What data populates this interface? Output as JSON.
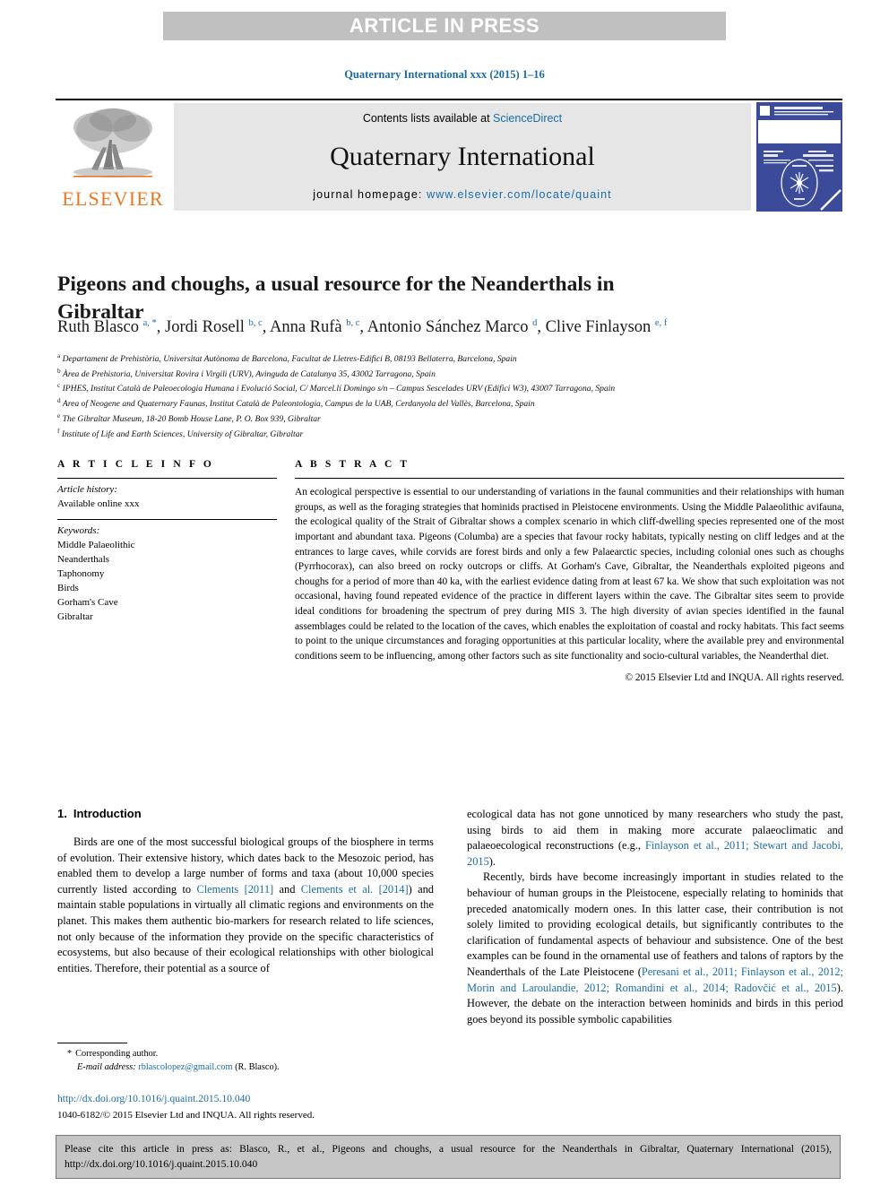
{
  "banner": {
    "label": "ARTICLE IN PRESS"
  },
  "journal_ref": "Quaternary International xxx (2015) 1–16",
  "masthead": {
    "publisher": "ELSEVIER",
    "contents_prefix": "Contents lists available at ",
    "contents_link": "ScienceDirect",
    "journal_title": "Quaternary International",
    "homepage_prefix": "journal homepage: ",
    "homepage_url": "www.elsevier.com/locate/quaint",
    "cover_caption": "Quaternary International"
  },
  "article": {
    "title": "Pigeons and choughs, a usual resource for the Neanderthals in Gibraltar",
    "authors": [
      {
        "name": "Ruth Blasco",
        "marks": "a, *"
      },
      {
        "name": "Jordi Rosell",
        "marks": "b, c"
      },
      {
        "name": "Anna Rufà",
        "marks": "b, c"
      },
      {
        "name": "Antonio Sánchez Marco",
        "marks": "d"
      },
      {
        "name": "Clive Finlayson",
        "marks": "e, f"
      }
    ],
    "affiliations": [
      {
        "mark": "a",
        "text": "Departament de Prehistòria, Universitat Autònoma de Barcelona, Facultat de Lletres-Edifici B, 08193 Bellaterra, Barcelona, Spain"
      },
      {
        "mark": "b",
        "text": "Àrea de Prehistoria, Universitat Rovira i Virgili (URV), Avinguda de Catalunya 35, 43002 Tarragona, Spain"
      },
      {
        "mark": "c",
        "text": "IPHES, Institut Català de Paleoecologia Humana i Evolució Social, C/ Marcel.lí Domingo s/n – Campus Sescelades URV (Edifici W3), 43007 Tarragona, Spain"
      },
      {
        "mark": "d",
        "text": "Area of Neogene and Quaternary Faunas, Institut Català de Paleontologia, Campus de la UAB, Cerdanyola del Vallès, Barcelona, Spain"
      },
      {
        "mark": "e",
        "text": "The Gibraltar Museum, 18-20 Bomb House Lane, P. O. Box 939, Gibraltar"
      },
      {
        "mark": "f",
        "text": "Institute of Life and Earth Sciences, University of Gibraltar, Gibraltar"
      }
    ]
  },
  "article_info": {
    "heading": "A R T I C L E  I N F O",
    "history_label": "Article history:",
    "history_value": "Available online xxx",
    "keywords_label": "Keywords:",
    "keywords": [
      "Middle Palaeolithic",
      "Neanderthals",
      "Taphonomy",
      "Birds",
      "Gorham's Cave",
      "Gibraltar"
    ]
  },
  "abstract": {
    "heading": "A B S T R A C T",
    "body": "An ecological perspective is essential to our understanding of variations in the faunal communities and their relationships with human groups, as well as the foraging strategies that hominids practised in Pleistocene environments. Using the Middle Palaeolithic avifauna, the ecological quality of the Strait of Gibraltar shows a complex scenario in which cliff-dwelling species represented one of the most important and abundant taxa. Pigeons (Columba) are a species that favour rocky habitats, typically nesting on cliff ledges and at the entrances to large caves, while corvids are forest birds and only a few Palaearctic species, including colonial ones such as choughs (Pyrrhocorax), can also breed on rocky outcrops or cliffs. At Gorham's Cave, Gibraltar, the Neanderthals exploited pigeons and choughs for a period of more than 40 ka, with the earliest evidence dating from at least 67 ka. We show that such exploitation was not occasional, having found repeated evidence of the practice in different layers within the cave. The Gibraltar sites seem to provide ideal conditions for broadening the spectrum of prey during MIS 3. The high diversity of avian species identified in the faunal assemblages could be related to the location of the caves, which enables the exploitation of coastal and rocky habitats. This fact seems to point to the unique circumstances and foraging opportunities at this particular locality, where the available prey and environmental conditions seem to be influencing, among other factors such as site functionality and socio-cultural variables, the Neanderthal diet.",
    "copyright": "© 2015 Elsevier Ltd and INQUA. All rights reserved."
  },
  "introduction": {
    "number": "1.",
    "heading": "Introduction",
    "left_para_1_a": "Birds are one of the most successful biological groups of the biosphere in terms of evolution. Their extensive history, which dates back to the Mesozoic period, has enabled them to develop a large number of forms and taxa (about 10,000 species currently listed according to ",
    "left_cite_1": "Clements [2011]",
    "left_para_1_b": " and ",
    "left_cite_2": "Clements et al. [2014]",
    "left_para_1_c": ") and maintain stable populations in virtually all climatic regions and environments on the planet. This makes them authentic bio-markers for research related to life sciences, not only because of the information they provide on the specific characteristics of ecosystems, but also because of their ecological relationships with other biological entities. Therefore, their potential as a source of",
    "right_para_1_a": "ecological data has not gone unnoticed by many researchers who study the past, using birds to aid them in making more accurate palaeoclimatic and palaeoecological reconstructions (e.g., ",
    "right_cite_1": "Finlayson et al., 2011; Stewart and Jacobi, 2015",
    "right_para_1_b": ").",
    "right_para_2_a": "Recently, birds have become increasingly important in studies related to the behaviour of human groups in the Pleistocene, especially relating to hominids that preceded anatomically modern ones. In this latter case, their contribution is not solely limited to providing ecological details, but significantly contributes to the clarification of fundamental aspects of behaviour and subsistence. One of the best examples can be found in the ornamental use of feathers and talons of raptors by the Neanderthals of the Late Pleistocene (",
    "right_cite_2": "Peresani et al., 2011; Finlayson et al., 2012; Morin and Laroulandie, 2012; Romandini et al., 2014; Radovčić et al., 2015",
    "right_para_2_b": "). However, the debate on the interaction between hominids and birds in this period goes beyond its possible symbolic capabilities"
  },
  "footnote": {
    "corresponding_star": "*",
    "corresponding_label": "Corresponding author.",
    "email_label": "E-mail address:",
    "email": "rblascolopez@gmail.com",
    "email_owner": "(R. Blasco)."
  },
  "doi": {
    "url": "http://dx.doi.org/10.1016/j.quaint.2015.10.040",
    "issn_line": "1040-6182/© 2015 Elsevier Ltd and INQUA. All rights reserved."
  },
  "cite_box": {
    "text": "Please cite this article in press as: Blasco, R., et al., Pigeons and choughs, a usual resource for the Neanderthals in Gibraltar, Quaternary International (2015), http://dx.doi.org/10.1016/j.quaint.2015.10.040"
  },
  "colors": {
    "link": "#1a6ca8",
    "elsevier_orange": "#e87722",
    "banner_gray": "#c0c0c0",
    "masthead_gray": "#e6e6e6",
    "citebox_gray": "#c6c6c6",
    "cover_blue": "#3b4b9a"
  }
}
